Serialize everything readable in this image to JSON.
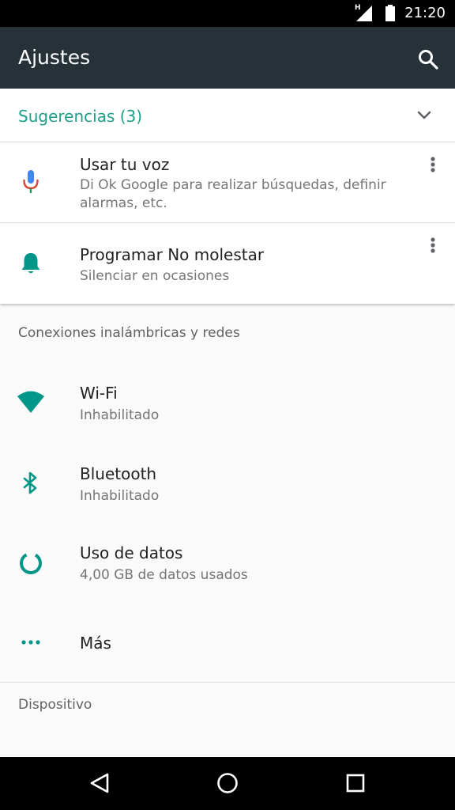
{
  "status_bar": {
    "time": "21:20",
    "network_type": "H",
    "icons": [
      "signal-icon",
      "battery-icon"
    ]
  },
  "app_bar": {
    "title": "Ajustes",
    "search_icon": "search-icon"
  },
  "suggestions": {
    "header": "Sugerencias (3)",
    "items": [
      {
        "title": "Usar tu voz",
        "subtitle": "Di Ok Google para realizar búsquedas, definir alarmas, etc.",
        "icon": "microphone-icon"
      },
      {
        "title": "Programar No molestar",
        "subtitle": "Silenciar en ocasiones",
        "icon": "bell-icon"
      }
    ]
  },
  "sections": [
    {
      "title": "Conexiones inalámbricas y redes",
      "items": [
        {
          "title": "Wi-Fi",
          "subtitle": "Inhabilitado",
          "icon": "wifi-icon"
        },
        {
          "title": "Bluetooth",
          "subtitle": "Inhabilitado",
          "icon": "bluetooth-icon"
        },
        {
          "title": "Uso de datos",
          "subtitle": "4,00 GB de datos usados",
          "icon": "data-usage-icon"
        },
        {
          "title": "Más",
          "icon": "more-icon"
        }
      ]
    },
    {
      "title": "Dispositivo"
    }
  ],
  "navigation": {
    "buttons": [
      "back-icon",
      "home-icon",
      "recents-icon"
    ]
  },
  "colors": {
    "accent": "#1e9e8a",
    "app_bar": "#263238",
    "icon_teal": "#009688",
    "mic_blue": "#4285f4",
    "mic_red": "#db4437"
  }
}
